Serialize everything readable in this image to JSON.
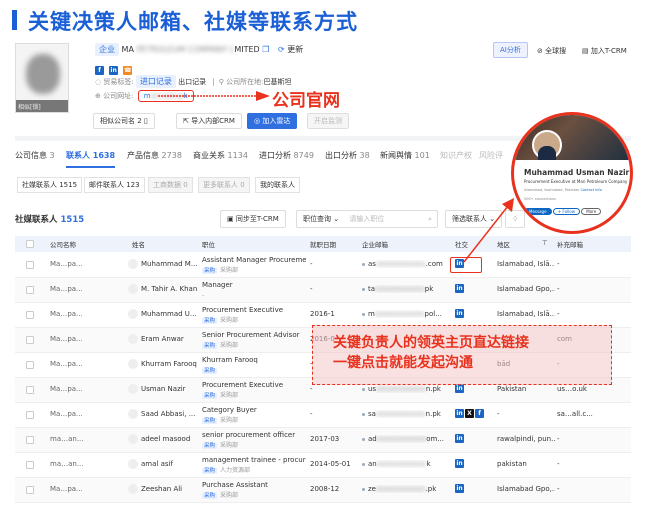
{
  "banner": {
    "title": "关键决策人邮箱、社媒等联系方式",
    "accent": "#1a5fd6"
  },
  "company": {
    "type_tag": "企业",
    "name_prefix": "MA",
    "name_suffix": "MITED",
    "refresh": "更新",
    "logo_caption": "相似[锁]",
    "trade_label": "贸易标签:",
    "trade_import": "进口记录",
    "trade_export": "出口记录",
    "location_label": "公司所在地:",
    "location": "巴基斯坦",
    "website_label": "公司网址:",
    "website_prefix": "m",
    "website_suffix": "k"
  },
  "actions": {
    "ai": "AI分析",
    "global": "全球搜",
    "tcrm": "加入T-CRM",
    "similar": "相似公司名 2",
    "import_crm": "导入内部CRM",
    "radar": "加入雷达",
    "monitor": "开启监测"
  },
  "annotations": {
    "website": "公司官网",
    "linkedin_line1": "关键负责人的领英主页直达链接",
    "linkedin_line2": "一键点击就能发起沟通",
    "color": "#e8321e"
  },
  "tabs": [
    {
      "label": "公司信息",
      "count": "3"
    },
    {
      "label": "联系人",
      "count": "1638"
    },
    {
      "label": "产品信息",
      "count": "2738"
    },
    {
      "label": "商业关系",
      "count": "1134"
    },
    {
      "label": "进口分析",
      "count": "8749"
    },
    {
      "label": "出口分析",
      "count": "38"
    },
    {
      "label": "新闻舆情",
      "count": "101"
    },
    {
      "label": "知识产权",
      "count": ""
    },
    {
      "label": "风险评",
      "count": ""
    }
  ],
  "subtabs": [
    "社媒联系人 1515",
    "邮件联系人 123",
    "工商数据 0",
    "更多联系人 0",
    "我的联系人"
  ],
  "list": {
    "title": "社媒联系人",
    "count": "1515",
    "sync": "同步至T-CRM",
    "position_query": "职位查询",
    "position_placeholder": "请输入职位",
    "filter": "筛选联系人"
  },
  "columns": [
    "公司名称",
    "姓名",
    "职位",
    "就职日期",
    "企业邮箱",
    "社交",
    "地区",
    "补充邮箱"
  ],
  "rows": [
    {
      "company": "Ma…pa...",
      "name": "Muhammad M...",
      "title": "Assistant Manager Procurement",
      "tag": "采购",
      "dept": "采购部",
      "date": "-",
      "email_a": "as",
      "email_b": ".com",
      "social": [
        "in"
      ],
      "region": "Islamabad, Islā...",
      "extra": "-"
    },
    {
      "company": "Ma…pa...",
      "name": "M. Tahir A. Khan",
      "title": "Manager",
      "tag": "",
      "dept": "-",
      "date": "-",
      "email_a": "ta",
      "email_b": "pk",
      "social": [
        "in"
      ],
      "region": "Islamabad Gpo,...",
      "extra": "-"
    },
    {
      "company": "Ma…pa...",
      "name": "Muhammad U...",
      "title": "Procurement Executive",
      "tag": "采购",
      "dept": "采购部",
      "date": "2016-1",
      "email_a": "m",
      "email_b": "pol...",
      "social": [
        "in"
      ],
      "region": "Islamabad, Islā...",
      "extra": "-"
    },
    {
      "company": "Ma…pa...",
      "name": "Eram Anwar",
      "title": "Senior Procurement Advisor",
      "tag": "采购",
      "dept": "采购部",
      "date": "2016-0",
      "email_a": "",
      "email_b": "",
      "social": [],
      "region": "",
      "extra": "com"
    },
    {
      "company": "Ma…pa...",
      "name": "Khurram Farooq",
      "title": "Khurram Farooq",
      "tag": "采购",
      "dept": "",
      "date": "-",
      "email_a": "",
      "email_b": "",
      "social": [],
      "region": "bād",
      "extra": "-"
    },
    {
      "company": "Ma…pa...",
      "name": "Usman Nazir",
      "title": "Procurement Executive",
      "tag": "采购",
      "dept": "采购部",
      "date": "-",
      "email_a": "us",
      "email_b": "n.pk",
      "social": [
        "in"
      ],
      "region": "Pakistan",
      "extra": "us…o.uk"
    },
    {
      "company": "Ma…pa...",
      "name": "Saad Abbasi, ...",
      "title": "Category Buyer",
      "tag": "采购",
      "dept": "采购部",
      "date": "-",
      "email_a": "sa",
      "email_b": "n.pk",
      "social": [
        "in",
        "X",
        "f"
      ],
      "region": "-",
      "extra": "sa…all.c..."
    },
    {
      "company": "ma…an...",
      "name": "adeel masood",
      "title": "senior procurement officer",
      "tag": "采购",
      "dept": "采购部",
      "date": "2017-03",
      "email_a": "ad",
      "email_b": "om...",
      "social": [
        "in"
      ],
      "region": "rawalpindi, pun...",
      "extra": "-"
    },
    {
      "company": "ma…an...",
      "name": "amal asif",
      "title": "management trainee - procurem...",
      "tag": "采购",
      "dept": "人力资源部",
      "date": "2014-05-01",
      "email_a": "an",
      "email_b": "k",
      "social": [
        "in"
      ],
      "region": "pakistan",
      "extra": "-"
    },
    {
      "company": "Ma…pa...",
      "name": "Zeeshan Ali",
      "title": "Purchase Assistant",
      "tag": "采购",
      "dept": "采购部",
      "date": "2008-12",
      "email_a": "ze",
      "email_b": ".pk",
      "social": [
        "in"
      ],
      "region": "Islamabad Gpo,...",
      "extra": "-"
    }
  ],
  "linkedin_card": {
    "name": "Muhammad Usman Nazir",
    "headline": "Procurement Executive at Mari Petroleum Company",
    "location": "Islamabad, Islamabad, Pakistan",
    "contact": "Contact info",
    "connections": "500+ connections",
    "message": "Message",
    "follow": "+ Follow",
    "more": "More"
  }
}
